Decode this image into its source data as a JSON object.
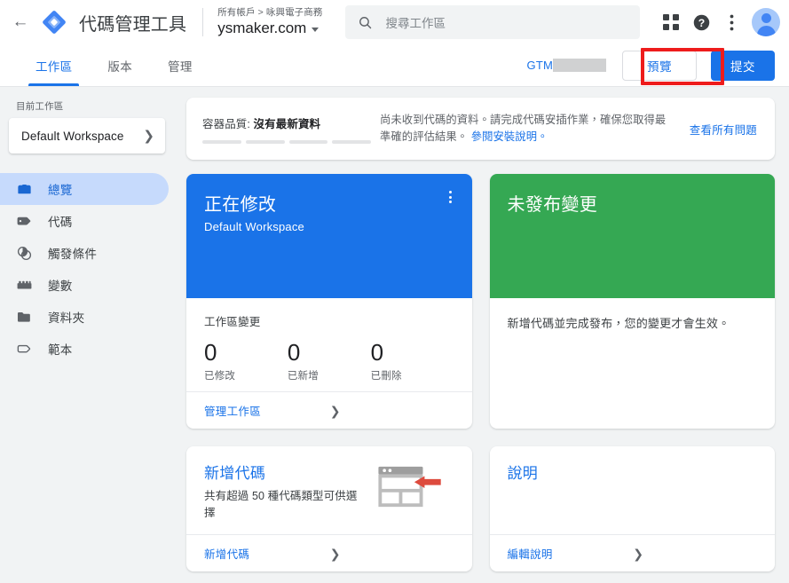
{
  "topbar": {
    "back_icon": "arrow-left-icon",
    "logo_icon": "gtm-diamond-logo",
    "brand_title": "代碼管理工具",
    "account_breadcrumb": "所有帳戶 > 咏興電子商務",
    "container_name": "ysmaker.com",
    "search_placeholder": "搜尋工作區",
    "search_icon": "search-icon",
    "apps_icon": "apps-grid-icon",
    "help_icon": "help-circle-icon",
    "more_icon": "more-vert-icon",
    "avatar": "user-avatar"
  },
  "tabbar": {
    "tabs": [
      {
        "label": "工作區",
        "active": true
      },
      {
        "label": "版本",
        "active": false
      },
      {
        "label": "管理",
        "active": false
      }
    ],
    "gtm_id_label": "GTM",
    "gtm_id_value": "",
    "preview_label": "預覽",
    "submit_label": "提交",
    "highlight_color": "#ee1c1c"
  },
  "sidebar": {
    "current_workspace_label": "目前工作區",
    "workspace_name": "Default Workspace",
    "items": [
      {
        "label": "總覽",
        "icon": "container-box-icon",
        "active": true
      },
      {
        "label": "代碼",
        "icon": "tag-icon",
        "active": false
      },
      {
        "label": "觸發條件",
        "icon": "trigger-circles-icon",
        "active": false
      },
      {
        "label": "變數",
        "icon": "variable-brick-icon",
        "active": false
      },
      {
        "label": "資料夾",
        "icon": "folder-icon",
        "active": false
      },
      {
        "label": "範本",
        "icon": "template-tag-outline-icon",
        "active": false
      }
    ]
  },
  "banner": {
    "quality_prefix": "容器品質: ",
    "quality_status": "沒有最新資料",
    "bars": 4,
    "message": "尚未收到代碼的資料。請完成代碼安插作業，確保您取得最準確的評估結果。 ",
    "message_link": "參閱安裝說明。",
    "all_issues_link": "查看所有問題"
  },
  "cards": {
    "workspace": {
      "hero_title": "正在修改",
      "hero_sub": "Default Workspace",
      "hero_color": "#1a73e8",
      "menu_icon": "more-vert-icon",
      "changes_label": "工作區變更",
      "stats": [
        {
          "value": "0",
          "caption": "已修改"
        },
        {
          "value": "0",
          "caption": "已新增"
        },
        {
          "value": "0",
          "caption": "已刪除"
        }
      ],
      "footer_link": "管理工作區"
    },
    "unpublished": {
      "hero_title": "未發布變更",
      "hero_color": "#35a853",
      "body_text": "新增代碼並完成發布，您的變更才會生效。"
    },
    "new_tag": {
      "title": "新增代碼",
      "description": "共有超過 50 種代碼類型可供選擇",
      "illustration": "browser-tag-illustration",
      "footer_link": "新增代碼"
    },
    "help": {
      "title": "說明",
      "footer_link": "編輯說明"
    }
  }
}
